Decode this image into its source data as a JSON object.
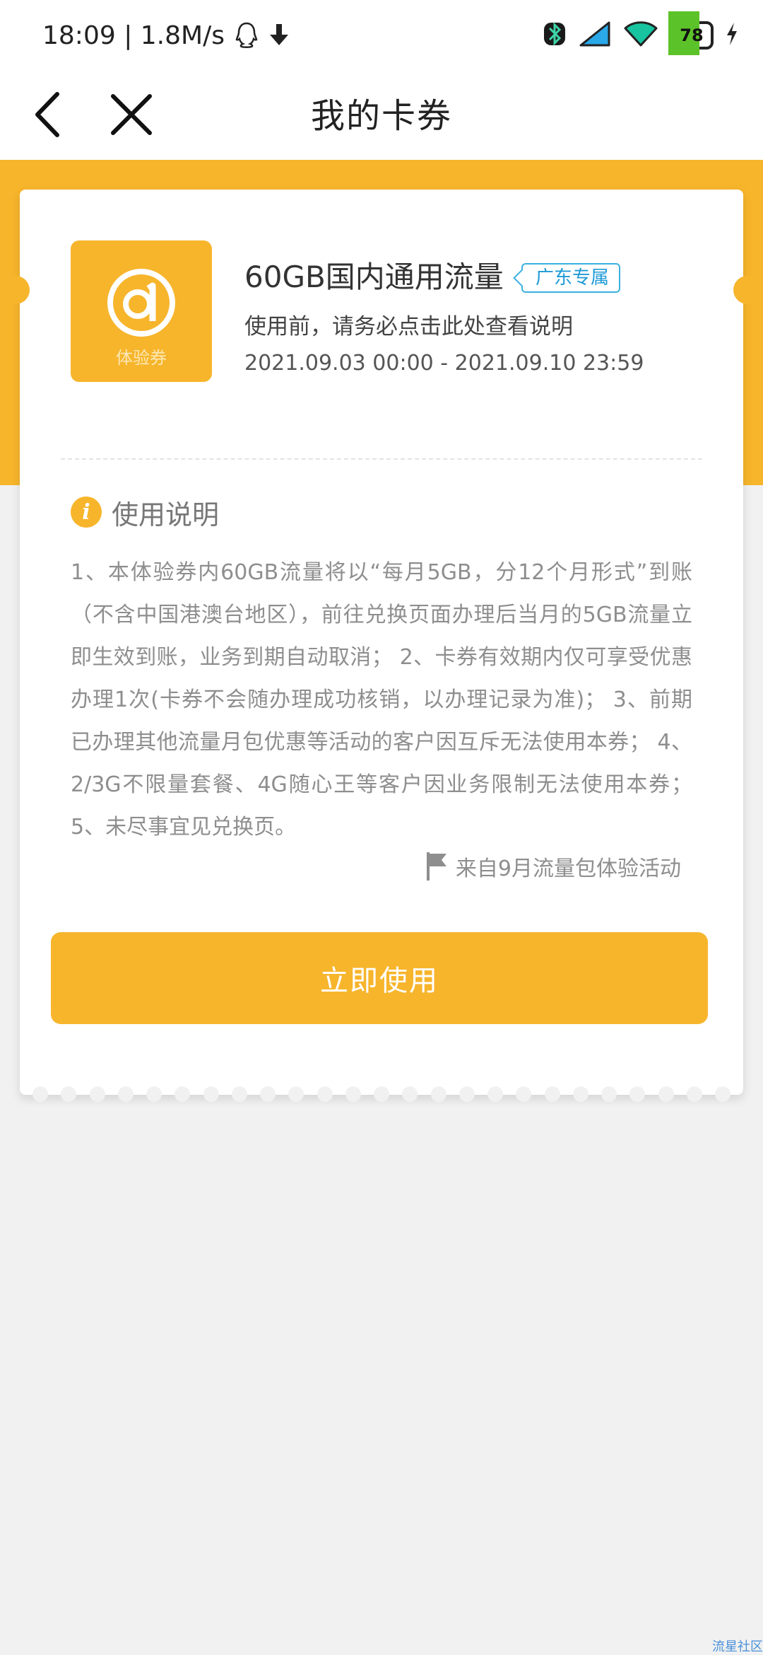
{
  "status_bar": {
    "time_speed": "18:09 | 1.8M/s",
    "battery": "78"
  },
  "header": {
    "title": "我的卡券"
  },
  "coupon": {
    "icon_label": "体验券",
    "title": "60GB国内通用流量",
    "badge": "广东专属",
    "note": "使用前，请务必点击此处查看说明",
    "validity": "2021.09.03 00:00 - 2021.09.10 23:59"
  },
  "usage": {
    "heading": "使用说明",
    "text": "1、本体验券内60GB流量将以“每月5GB，分12个月形式”到账（不含中国港澳台地区），前往兑换页面办理后当月的5GB流量立即生效到账，业务到期自动取消； 2、卡券有效期内仅可享受优惠办理1次(卡券不会随办理成功核销，以办理记录为准)； 3、前期已办理其他流量月包优惠等活动的客户因互斥无法使用本券； 4、2/3G不限量套餐、4G随心王等客户因业务限制无法使用本券； 5、未尽事宜见兑换页。",
    "source": "来自9月流量包体验活动"
  },
  "actions": {
    "use_now": "立即使用"
  },
  "watermark": "流星社区",
  "colors": {
    "accent": "#f7b52c",
    "badge_blue": "#1e9ad6",
    "battery_green": "#5cc229"
  }
}
